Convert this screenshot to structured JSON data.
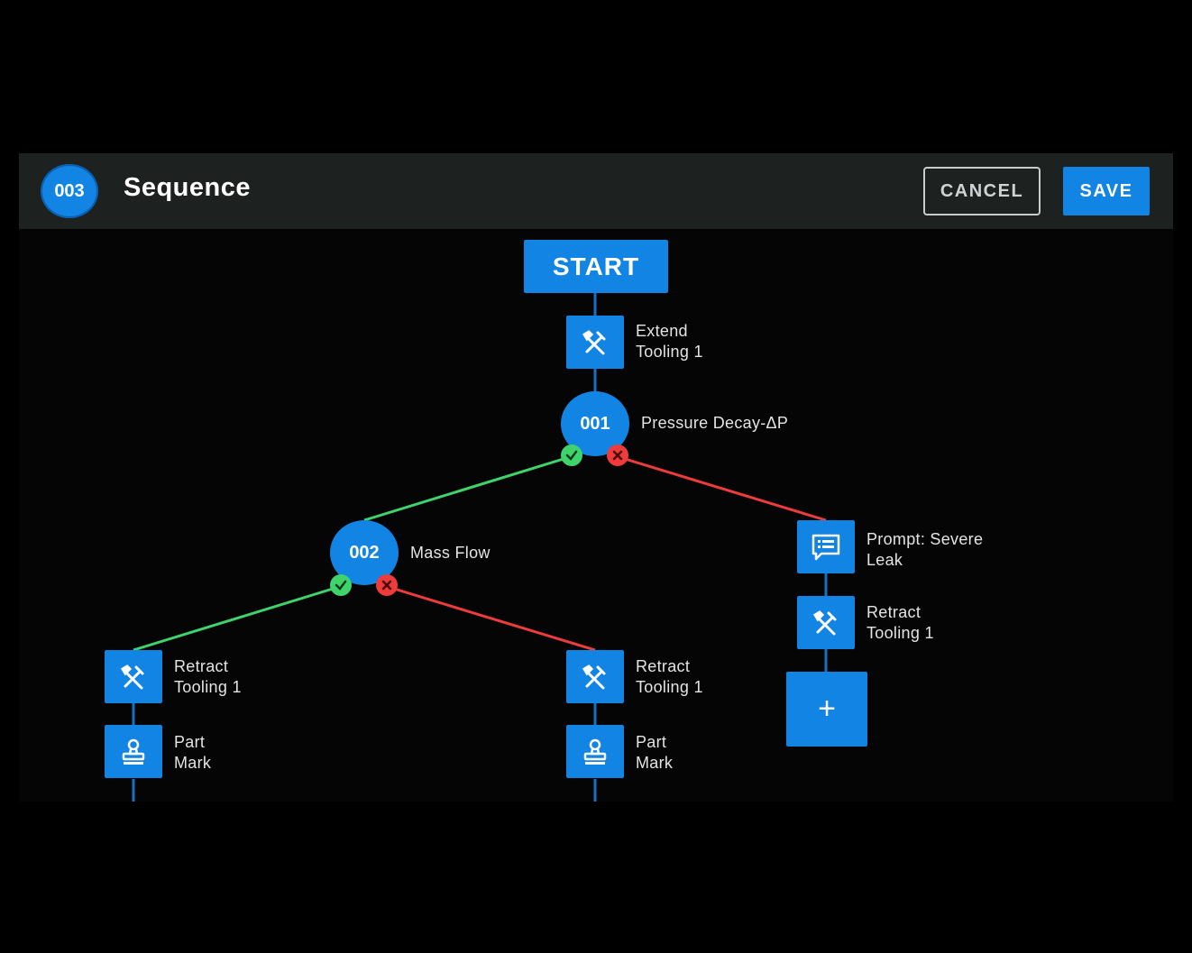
{
  "header": {
    "sequence_number": "003",
    "title": "Sequence",
    "cancel_label": "CANCEL",
    "save_label": "SAVE"
  },
  "colors": {
    "accent_blue": "#1184e4",
    "connector_blue": "#1a6fc0",
    "pass_green": "#3ed36b",
    "fail_red": "#ee3b3b",
    "header_bg": "#1d2221"
  },
  "flow": {
    "start_label": "START",
    "extend_tooling": {
      "icon": "tools-icon",
      "label": "Extend\nTooling 1"
    },
    "test_001": {
      "number": "001",
      "label": "Pressure Decay-ΔP"
    },
    "test_002": {
      "number": "002",
      "label": "Mass Flow"
    },
    "prompt_severe_leak": {
      "icon": "message-icon",
      "label": "Prompt: Severe\nLeak"
    },
    "fail_retract": {
      "icon": "tools-icon",
      "label": "Retract\nTooling 1"
    },
    "add_step_label": "+",
    "pass_pass_retract": {
      "icon": "tools-icon",
      "label": "Retract\nTooling 1"
    },
    "pass_pass_mark": {
      "icon": "stamp-icon",
      "label": "Part\nMark"
    },
    "pass_fail_retract": {
      "icon": "tools-icon",
      "label": "Retract\nTooling 1"
    },
    "pass_fail_mark": {
      "icon": "stamp-icon",
      "label": "Part\nMark"
    }
  }
}
